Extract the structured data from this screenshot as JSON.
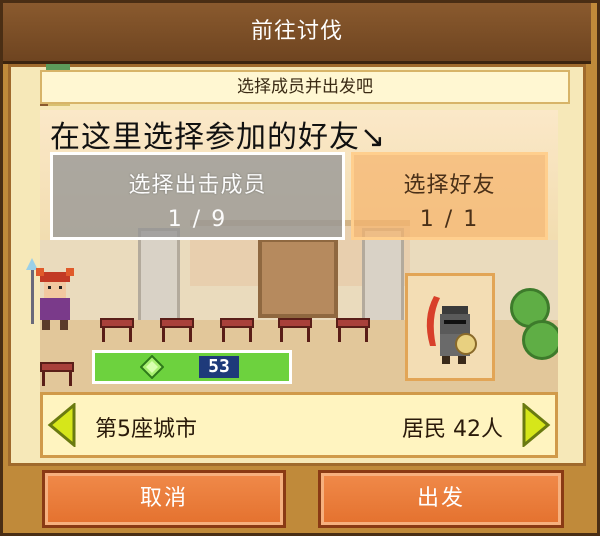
{
  "dialog": {
    "title": "前往讨伐",
    "hint": "选择成员并出发吧",
    "instruction": "在这里选择参加的好友↘"
  },
  "members_panel": {
    "title": "选择出击成员",
    "count": "1 / 9"
  },
  "friend_panel": {
    "title": "选择好友",
    "count": "1 / 1"
  },
  "score": {
    "value": "53"
  },
  "city": {
    "name": "第5座城市",
    "population": "居民 42人"
  },
  "buttons": {
    "cancel": "取消",
    "depart": "出发"
  },
  "colors": {
    "accent": "#e4712e",
    "frame": "#c08a3a",
    "header": "#6e4420",
    "score_bar": "#6dd23e"
  }
}
